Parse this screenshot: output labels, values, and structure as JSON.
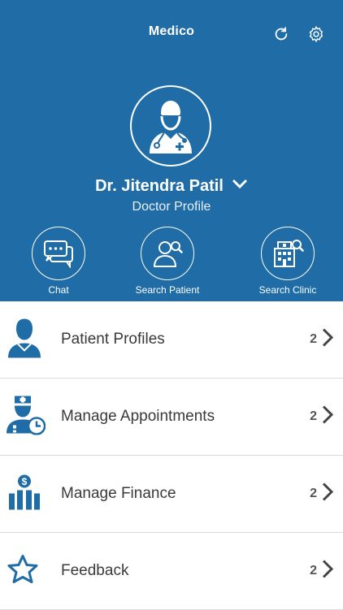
{
  "header": {
    "title": "Medico",
    "refresh_icon": "refresh-icon",
    "settings_icon": "gear-icon"
  },
  "profile": {
    "name": "Dr. Jitendra Patil",
    "role": "Doctor Profile",
    "avatar_icon": "doctor-avatar-icon"
  },
  "actions": [
    {
      "label": "Chat",
      "icon": "chat-icon"
    },
    {
      "label": "Search Patient",
      "icon": "search-patient-icon"
    },
    {
      "label": "Search Clinic",
      "icon": "search-clinic-icon"
    }
  ],
  "menu": [
    {
      "label": "Patient Profiles",
      "count": "2",
      "icon": "patient-icon"
    },
    {
      "label": "Manage Appointments",
      "count": "2",
      "icon": "appointment-icon"
    },
    {
      "label": "Manage Finance",
      "count": "2",
      "icon": "finance-icon"
    },
    {
      "label": "Feedback",
      "count": "2",
      "icon": "star-icon"
    }
  ],
  "colors": {
    "primary": "#1f6ca6",
    "text": "#3a3a3a",
    "divider": "#d9d9d9"
  }
}
